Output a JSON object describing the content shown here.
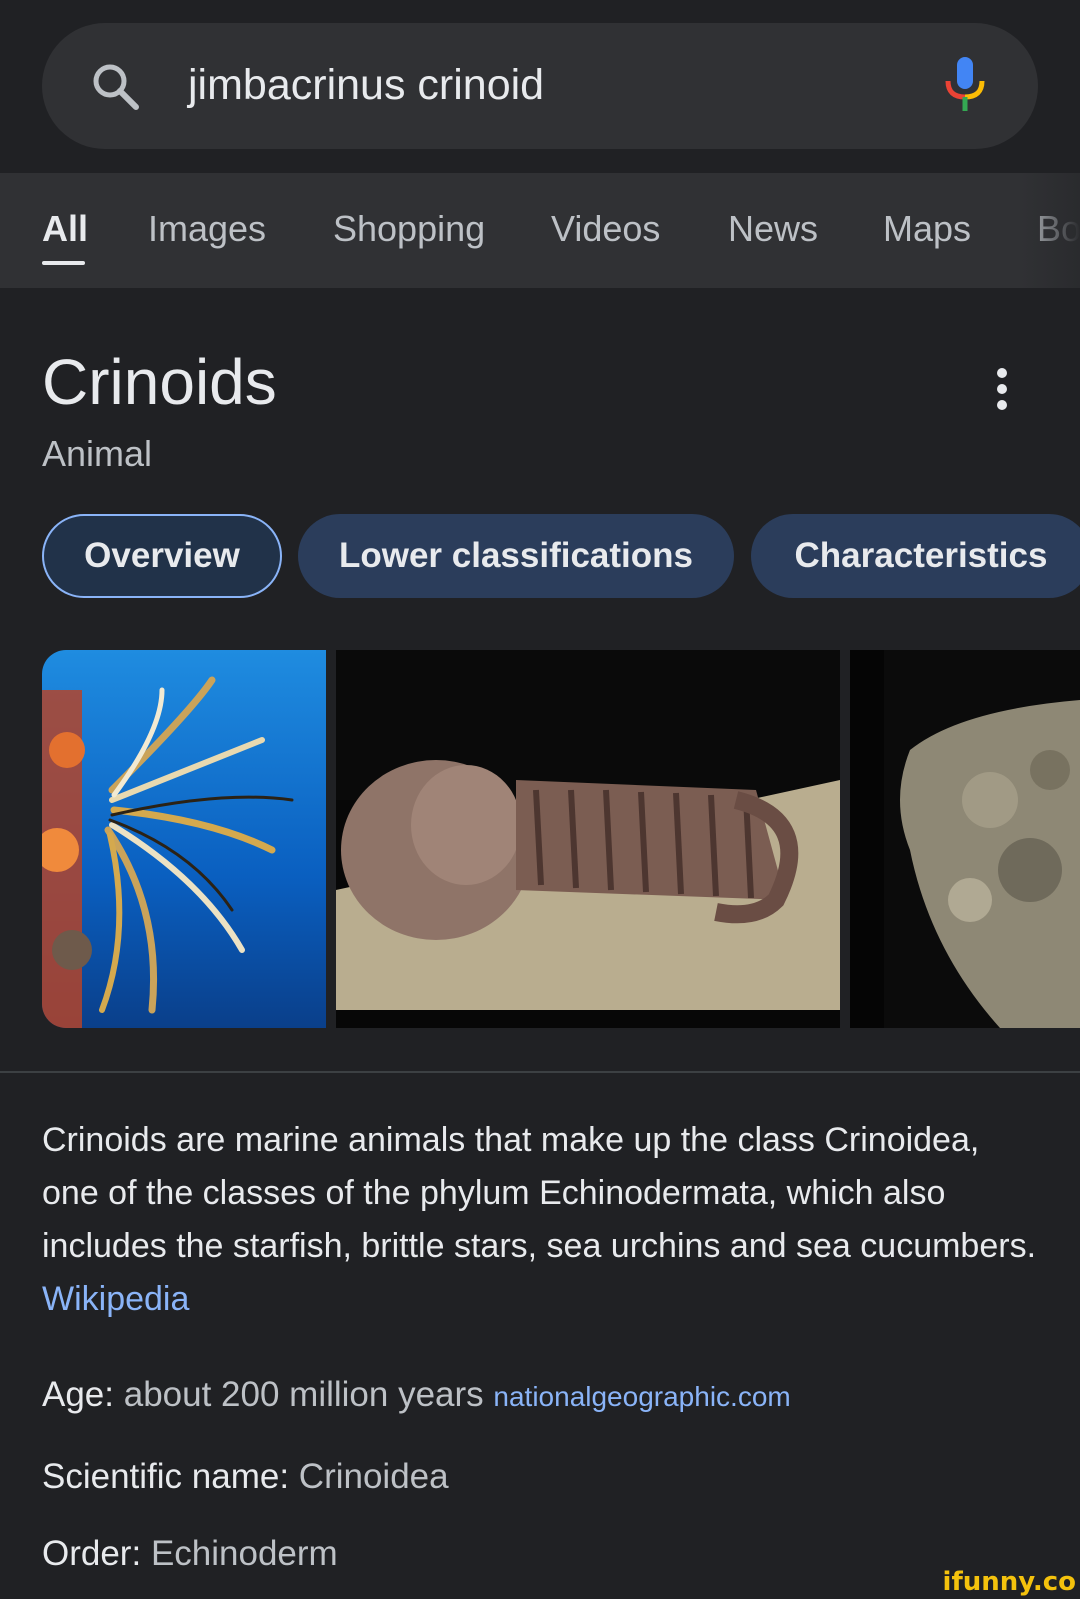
{
  "search": {
    "query": "jimbacrinus crinoid"
  },
  "tabs": [
    {
      "label": "All"
    },
    {
      "label": "Images"
    },
    {
      "label": "Shopping"
    },
    {
      "label": "Videos"
    },
    {
      "label": "News"
    },
    {
      "label": "Maps"
    },
    {
      "label": "Bo"
    }
  ],
  "knowledge_panel": {
    "title": "Crinoids",
    "subtitle": "Animal",
    "chips": [
      {
        "label": "Overview"
      },
      {
        "label": "Lower classifications"
      },
      {
        "label": "Characteristics"
      }
    ],
    "description": "Crinoids are marine animals that make up the class Crinoidea, one of the classes of the phylum Echinodermata, which also includes the starfish, brittle stars, sea urchins and sea cucumbers.",
    "description_source": "Wikipedia",
    "facts": [
      {
        "label": "Age:",
        "value": "about 200 million years",
        "source": "nationalgeographic.com"
      },
      {
        "label": "Scientific name:",
        "value": "Crinoidea"
      },
      {
        "label": "Order:",
        "value": "Echinoderm"
      }
    ]
  },
  "watermark": "ifunny.co",
  "icons": {
    "search": "search-icon",
    "mic": "microphone-icon",
    "more": "more-vert-icon"
  },
  "colors": {
    "background": "#202124",
    "link": "#8ab4f8",
    "chip_bg": "#2b3d5b"
  }
}
